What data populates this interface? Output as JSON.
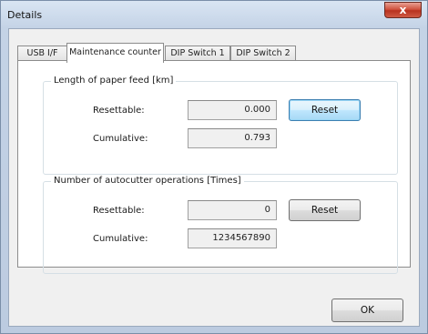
{
  "window": {
    "title": "Details",
    "close_glyph": "x"
  },
  "tabs": [
    {
      "label": "USB I/F"
    },
    {
      "label": "Maintenance counter"
    },
    {
      "label": "DIP Switch 1"
    },
    {
      "label": "DIP Switch 2"
    }
  ],
  "active_tab": "Maintenance counter",
  "paper_feed": {
    "title": "Length of paper feed [km]",
    "resettable_label": "Resettable:",
    "resettable_value": "0.000",
    "cumulative_label": "Cumulative:",
    "cumulative_value": "0.793",
    "reset_label": "Reset"
  },
  "autocutter": {
    "title": "Number of autocutter operations [Times]",
    "resettable_label": "Resettable:",
    "resettable_value": "0",
    "cumulative_label": "Cumulative:",
    "cumulative_value": "1234567890",
    "reset_label": "Reset"
  },
  "footer": {
    "ok_label": "OK"
  }
}
